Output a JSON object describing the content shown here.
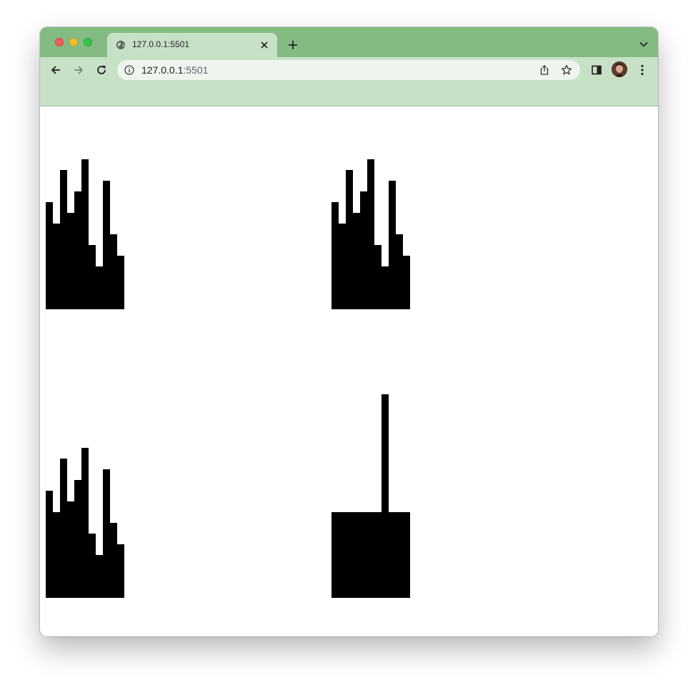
{
  "browser": {
    "tab_title": "127.0.0.1:5501",
    "url_host": "127.0.0.1",
    "url_port": ":5501",
    "tabstrip_color": "#83bb83",
    "toolbar_color": "#c7e1c7"
  },
  "chart_data": [
    {
      "type": "bar",
      "values": [
        10,
        8,
        13,
        9,
        11,
        14,
        6,
        4,
        12,
        7,
        5
      ],
      "ylim": [
        0,
        14
      ],
      "color": "#000000"
    },
    {
      "type": "bar",
      "values": [
        10,
        8,
        13,
        9,
        11,
        14,
        6,
        4,
        12,
        7,
        5
      ],
      "ylim": [
        0,
        14
      ],
      "color": "#000000"
    },
    {
      "type": "bar",
      "values": [
        10,
        8,
        13,
        9,
        11,
        14,
        6,
        4,
        12,
        7,
        5
      ],
      "ylim": [
        0,
        14
      ],
      "color": "#000000"
    },
    {
      "type": "bar",
      "values": [
        8,
        8,
        8,
        8,
        8,
        8,
        8,
        19,
        8,
        8,
        8
      ],
      "ylim": [
        0,
        19
      ],
      "color": "#000000"
    }
  ]
}
